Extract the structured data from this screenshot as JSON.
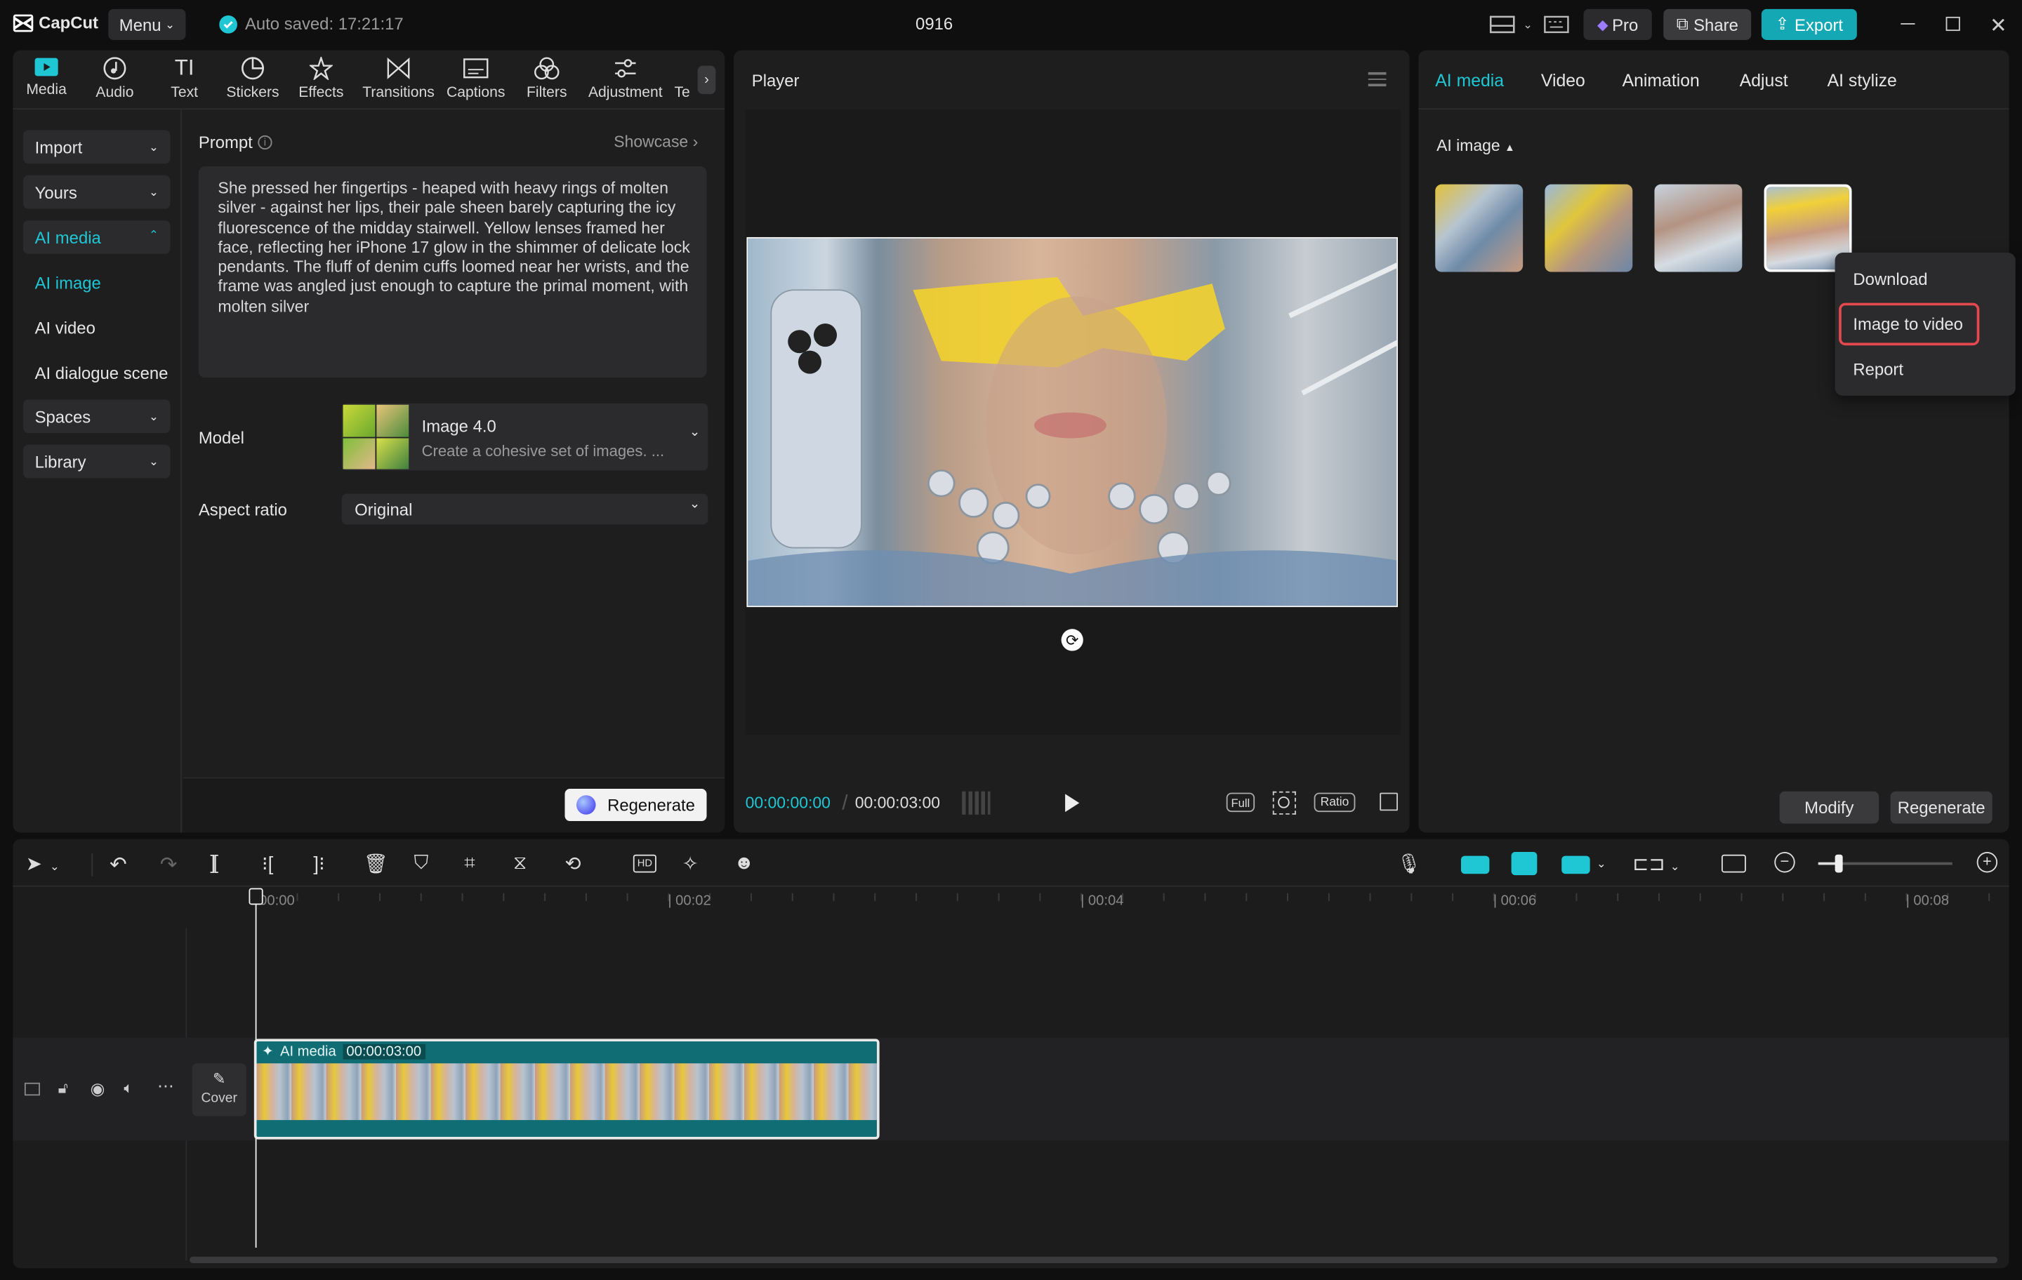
{
  "app": {
    "name": "CapCut",
    "menu_label": "Menu",
    "autosave": "Auto saved: 17:21:17",
    "project_title": "0916",
    "pro_label": "Pro",
    "share_label": "Share",
    "export_label": "Export"
  },
  "toolbar": {
    "items": [
      "Media",
      "Audio",
      "Text",
      "Stickers",
      "Effects",
      "Transitions",
      "Captions",
      "Filters",
      "Adjustment",
      "Te"
    ]
  },
  "sidebar": {
    "import": "Import",
    "yours": "Yours",
    "ai_media": "AI media",
    "ai_image": "AI image",
    "ai_video": "AI video",
    "ai_dialogue": "AI dialogue scene",
    "spaces": "Spaces",
    "library": "Library"
  },
  "prompt": {
    "label": "Prompt",
    "showcase": "Showcase",
    "text": "She pressed her fingertips - heaped with heavy rings of molten silver - against her lips, their pale sheen barely capturing the icy fluorescence of the midday stairwell. Yellow lenses framed her face, reflecting her iPhone 17 glow in the shimmer of delicate lock pendants. The fluff of denim cuffs loomed near her wrists, and the frame was angled just enough to capture the primal moment, with molten silver"
  },
  "model": {
    "label": "Model",
    "name": "Image 4.0",
    "desc": "Create a cohesive set of images. ..."
  },
  "aspect": {
    "label": "Aspect ratio",
    "value": "Original"
  },
  "regenerate_label": "Regenerate",
  "player": {
    "title": "Player",
    "current": "00:00:00:00",
    "total": "00:00:03:00",
    "full": "Full",
    "ratio": "Ratio"
  },
  "right": {
    "tabs": [
      "AI media",
      "Video",
      "Animation",
      "Adjust",
      "AI stylize"
    ],
    "section": "AI image",
    "modify": "Modify",
    "regenerate": "Regenerate"
  },
  "context_menu": {
    "download": "Download",
    "image_to_video": "Image to video",
    "report": "Report"
  },
  "timeline": {
    "ticks": [
      "00:00",
      "00:02",
      "00:04",
      "00:06",
      "00:08"
    ],
    "clip_label": "AI media",
    "clip_duration": "00:00:03:00",
    "cover_label": "Cover"
  },
  "colors": {
    "accent": "#1fc7d4",
    "highlight": "#e5484d",
    "bg": "#0f0f10",
    "panel": "#1e1e1f"
  }
}
